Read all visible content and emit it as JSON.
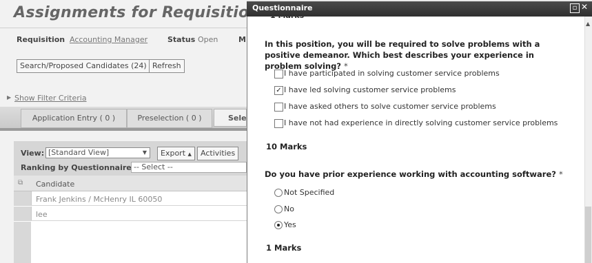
{
  "background": {
    "title": "Assignments for Requisition:",
    "requisition_label": "Requisition",
    "requisition_value": "Accounting Manager",
    "status_label": "Status",
    "status_value": "Open",
    "third_label_partial": "M",
    "search_button": "Search/Proposed Candidates (24)",
    "refresh_button": "Refresh",
    "show_filter": "Show Filter Criteria",
    "tabs": [
      "Application Entry ( 0 )",
      "Preselection ( 0 )",
      "Sele"
    ],
    "view_label": "View:",
    "view_value": "[Standard View]",
    "export_button": "Export",
    "activities_button": "Activities",
    "ranking_label": "Ranking by Questionnaire:",
    "ranking_value": "-- Select --",
    "column_header": "Candidate",
    "rows": [
      "Frank Jenkins / McHenry IL 60050",
      "lee"
    ]
  },
  "dialog": {
    "title": "Questionnaire",
    "q1": {
      "text": "In this position, you will be required to solve problems with a positive demeanor. Which best describes your experience in problem solving?",
      "required": "*",
      "options": [
        {
          "label": "I have participated in solving customer service problems",
          "checked": false
        },
        {
          "label": "I have led solving customer service problems",
          "checked": true
        },
        {
          "label": "I have asked others to solve customer service problems",
          "checked": false
        },
        {
          "label": "I have not had experience in directly solving customer service problems",
          "checked": false
        }
      ],
      "marks": "10 Marks"
    },
    "q2": {
      "text": "Do you have prior experience working with accounting software?",
      "required": "*",
      "options": [
        {
          "label": "Not Specified",
          "selected": false
        },
        {
          "label": "No",
          "selected": false
        },
        {
          "label": "Yes",
          "selected": true
        }
      ],
      "marks": "1 Marks"
    }
  }
}
